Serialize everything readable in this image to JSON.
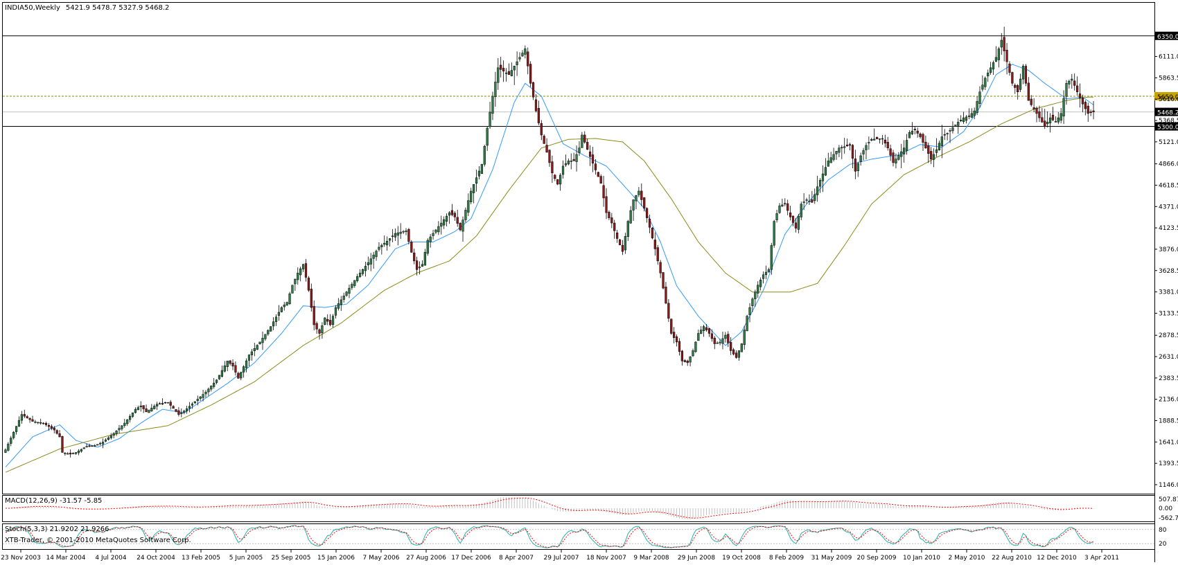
{
  "header": {
    "symbol": "INDIA50,Weekly",
    "ohlc": "5421.9 5478.7 5327.9 5468.2"
  },
  "colors": {
    "background": "#ffffff",
    "bull_body": "#2e7d46",
    "bear_body": "#8b1a1a",
    "wick": "#000000",
    "ma_fast": "#3399ff",
    "ma_slow": "#8b8b1a",
    "macd_signal": "#ff0000",
    "stoch_main": "#20b2aa",
    "stoch_signal": "#ff0000",
    "level_line": "#000000",
    "dotted_level": "#8b8b00"
  },
  "indicators": {
    "macd_label": "MACD(12,26,9) -31.57 -5.85",
    "stoch_label": "Stoch(5,3,3) 21.9202 21.9266",
    "copyright": "XTB-Trader, © 2001-2010 MetaQuotes Software Corp."
  },
  "chart_data": {
    "type": "candlestick",
    "price_ticks": [
      "6111.0",
      "5863.5",
      "5616.0",
      "5368.5",
      "5121.0",
      "4866.0",
      "4618.5",
      "4371.0",
      "4123.5",
      "3876.0",
      "3628.5",
      "3381.0",
      "3133.5",
      "2878.5",
      "2631.0",
      "2383.5",
      "2136.0",
      "1888.5",
      "1641.0",
      "1393.5",
      "1146.0"
    ],
    "ylim": [
      1146,
      6605
    ],
    "levels": [
      {
        "label": "6350.0",
        "value": 6350,
        "style": "solid"
      },
      {
        "label": "5650.0",
        "value": 5650,
        "style": "dotted"
      },
      {
        "label": "5468.2",
        "value": 5468.2,
        "style": "current"
      },
      {
        "label": "5300.0",
        "value": 5300,
        "style": "solid"
      }
    ],
    "x_labels": [
      "23 Nov 2003",
      "14 Mar 2004",
      "4 Jul 2004",
      "24 Oct 2004",
      "13 Feb 2005",
      "5 Jun 2005",
      "25 Sep 2005",
      "15 Jan 2006",
      "7 May 2006",
      "27 Aug 2006",
      "17 Dec 2006",
      "8 Apr 2007",
      "29 Jul 2007",
      "18 Nov 2007",
      "9 Mar 2008",
      "29 Jun 2008",
      "19 Oct 2008",
      "8 Feb 2009",
      "31 May 2009",
      "20 Sep 2009",
      "10 Jan 2010",
      "2 May 2010",
      "22 Aug 2010",
      "12 Dec 2010",
      "3 Apr 2011"
    ],
    "close_anchors": [
      [
        0,
        1550
      ],
      [
        6,
        1960
      ],
      [
        10,
        1880
      ],
      [
        14,
        1860
      ],
      [
        16,
        1820
      ],
      [
        18,
        1780
      ],
      [
        20,
        1700
      ],
      [
        21,
        1520
      ],
      [
        24,
        1500
      ],
      [
        26,
        1520
      ],
      [
        30,
        1590
      ],
      [
        33,
        1600
      ],
      [
        36,
        1640
      ],
      [
        40,
        1740
      ],
      [
        44,
        1860
      ],
      [
        48,
        2020
      ],
      [
        50,
        2060
      ],
      [
        52,
        1990
      ],
      [
        56,
        2080
      ],
      [
        60,
        2100
      ],
      [
        62,
        2030
      ],
      [
        64,
        1960
      ],
      [
        66,
        2000
      ],
      [
        70,
        2110
      ],
      [
        74,
        2220
      ],
      [
        78,
        2360
      ],
      [
        82,
        2580
      ],
      [
        84,
        2520
      ],
      [
        86,
        2380
      ],
      [
        90,
        2650
      ],
      [
        94,
        2800
      ],
      [
        98,
        2980
      ],
      [
        102,
        3200
      ],
      [
        104,
        3260
      ],
      [
        106,
        3460
      ],
      [
        108,
        3600
      ],
      [
        110,
        3700
      ],
      [
        112,
        3400
      ],
      [
        114,
        3000
      ],
      [
        116,
        2900
      ],
      [
        118,
        3080
      ],
      [
        120,
        3000
      ],
      [
        122,
        3200
      ],
      [
        126,
        3380
      ],
      [
        130,
        3560
      ],
      [
        134,
        3720
      ],
      [
        138,
        3900
      ],
      [
        141,
        3970
      ],
      [
        144,
        4060
      ],
      [
        148,
        4090
      ],
      [
        150,
        3840
      ],
      [
        152,
        3640
      ],
      [
        154,
        3700
      ],
      [
        156,
        3980
      ],
      [
        160,
        4140
      ],
      [
        164,
        4300
      ],
      [
        166,
        4250
      ],
      [
        168,
        4100
      ],
      [
        170,
        4330
      ],
      [
        172,
        4550
      ],
      [
        176,
        4860
      ],
      [
        178,
        5280
      ],
      [
        180,
        5650
      ],
      [
        182,
        5980
      ],
      [
        186,
        5900
      ],
      [
        190,
        6100
      ],
      [
        192,
        6200
      ],
      [
        194,
        5800
      ],
      [
        196,
        5480
      ],
      [
        198,
        5200
      ],
      [
        200,
        5000
      ],
      [
        202,
        4760
      ],
      [
        204,
        4630
      ],
      [
        206,
        4840
      ],
      [
        208,
        4900
      ],
      [
        210,
        4900
      ],
      [
        212,
        5050
      ],
      [
        213,
        5200
      ],
      [
        216,
        4950
      ],
      [
        220,
        4640
      ],
      [
        222,
        4300
      ],
      [
        224,
        4180
      ],
      [
        226,
        4000
      ],
      [
        228,
        3850
      ],
      [
        230,
        4200
      ],
      [
        232,
        4450
      ],
      [
        234,
        4550
      ],
      [
        236,
        4350
      ],
      [
        238,
        4130
      ],
      [
        240,
        3880
      ],
      [
        242,
        3600
      ],
      [
        244,
        3250
      ],
      [
        246,
        2900
      ],
      [
        248,
        2800
      ],
      [
        250,
        2580
      ],
      [
        252,
        2560
      ],
      [
        254,
        2700
      ],
      [
        256,
        2900
      ],
      [
        258,
        2980
      ],
      [
        260,
        2900
      ],
      [
        262,
        2780
      ],
      [
        264,
        2800
      ],
      [
        266,
        2880
      ],
      [
        268,
        2700
      ],
      [
        270,
        2620
      ],
      [
        272,
        2780
      ],
      [
        274,
        3100
      ],
      [
        276,
        3300
      ],
      [
        278,
        3460
      ],
      [
        280,
        3580
      ],
      [
        282,
        3640
      ],
      [
        284,
        4200
      ],
      [
        286,
        4380
      ],
      [
        288,
        4400
      ],
      [
        290,
        4250
      ],
      [
        292,
        4120
      ],
      [
        294,
        4400
      ],
      [
        296,
        4450
      ],
      [
        298,
        4420
      ],
      [
        300,
        4600
      ],
      [
        304,
        4900
      ],
      [
        308,
        5050
      ],
      [
        312,
        5080
      ],
      [
        314,
        4780
      ],
      [
        316,
        4960
      ],
      [
        318,
        5080
      ],
      [
        320,
        5150
      ],
      [
        324,
        5160
      ],
      [
        326,
        5050
      ],
      [
        328,
        4880
      ],
      [
        332,
        5050
      ],
      [
        334,
        5230
      ],
      [
        336,
        5260
      ],
      [
        338,
        5180
      ],
      [
        340,
        5050
      ],
      [
        342,
        4920
      ],
      [
        344,
        5030
      ],
      [
        346,
        5180
      ],
      [
        348,
        5220
      ],
      [
        352,
        5350
      ],
      [
        354,
        5400
      ],
      [
        356,
        5420
      ],
      [
        358,
        5480
      ],
      [
        360,
        5700
      ],
      [
        362,
        5860
      ],
      [
        364,
        5980
      ],
      [
        366,
        6100
      ],
      [
        368,
        6300
      ],
      [
        370,
        6050
      ],
      [
        372,
        5800
      ],
      [
        374,
        5700
      ],
      [
        376,
        6000
      ],
      [
        378,
        5600
      ],
      [
        380,
        5500
      ],
      [
        382,
        5400
      ],
      [
        384,
        5300
      ],
      [
        386,
        5400
      ],
      [
        388,
        5350
      ],
      [
        390,
        5450
      ],
      [
        392,
        5800
      ],
      [
        394,
        5850
      ],
      [
        396,
        5700
      ],
      [
        398,
        5560
      ],
      [
        400,
        5450
      ],
      [
        402,
        5468
      ]
    ],
    "ma_fast_anchors": [
      [
        0,
        1350
      ],
      [
        10,
        1700
      ],
      [
        20,
        1840
      ],
      [
        26,
        1660
      ],
      [
        34,
        1580
      ],
      [
        42,
        1680
      ],
      [
        50,
        1860
      ],
      [
        58,
        2020
      ],
      [
        66,
        1980
      ],
      [
        74,
        2150
      ],
      [
        82,
        2320
      ],
      [
        92,
        2560
      ],
      [
        102,
        2900
      ],
      [
        110,
        3220
      ],
      [
        118,
        3200
      ],
      [
        126,
        3240
      ],
      [
        134,
        3460
      ],
      [
        144,
        3880
      ],
      [
        150,
        3960
      ],
      [
        158,
        3960
      ],
      [
        166,
        4080
      ],
      [
        172,
        4230
      ],
      [
        180,
        4800
      ],
      [
        188,
        5580
      ],
      [
        192,
        5800
      ],
      [
        198,
        5650
      ],
      [
        206,
        5100
      ],
      [
        214,
        4960
      ],
      [
        222,
        4840
      ],
      [
        230,
        4560
      ],
      [
        236,
        4350
      ],
      [
        242,
        3960
      ],
      [
        248,
        3450
      ],
      [
        256,
        3100
      ],
      [
        266,
        2760
      ],
      [
        272,
        2920
      ],
      [
        280,
        3400
      ],
      [
        288,
        4050
      ],
      [
        296,
        4400
      ],
      [
        304,
        4680
      ],
      [
        312,
        4860
      ],
      [
        320,
        4920
      ],
      [
        330,
        4970
      ],
      [
        338,
        5090
      ],
      [
        346,
        5060
      ],
      [
        354,
        5240
      ],
      [
        360,
        5520
      ],
      [
        366,
        5900
      ],
      [
        372,
        6020
      ],
      [
        378,
        5950
      ],
      [
        384,
        5800
      ],
      [
        392,
        5620
      ],
      [
        398,
        5640
      ],
      [
        402,
        5550
      ]
    ],
    "ma_slow_anchors": [
      [
        0,
        1290
      ],
      [
        20,
        1560
      ],
      [
        40,
        1730
      ],
      [
        60,
        1830
      ],
      [
        76,
        2070
      ],
      [
        92,
        2340
      ],
      [
        110,
        2760
      ],
      [
        124,
        3020
      ],
      [
        140,
        3400
      ],
      [
        152,
        3600
      ],
      [
        164,
        3740
      ],
      [
        174,
        4030
      ],
      [
        186,
        4560
      ],
      [
        198,
        5050
      ],
      [
        208,
        5150
      ],
      [
        218,
        5160
      ],
      [
        228,
        5120
      ],
      [
        236,
        4900
      ],
      [
        246,
        4460
      ],
      [
        256,
        3960
      ],
      [
        266,
        3600
      ],
      [
        276,
        3380
      ],
      [
        290,
        3380
      ],
      [
        300,
        3480
      ],
      [
        310,
        3920
      ],
      [
        320,
        4400
      ],
      [
        332,
        4740
      ],
      [
        344,
        4940
      ],
      [
        356,
        5120
      ],
      [
        368,
        5330
      ],
      [
        380,
        5500
      ],
      [
        392,
        5600
      ],
      [
        400,
        5640
      ]
    ]
  }
}
